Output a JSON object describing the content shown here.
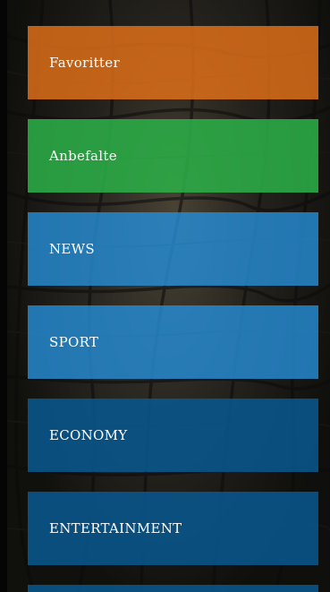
{
  "menu": {
    "items": [
      {
        "label": "Favoritter",
        "color": "#e47118"
      },
      {
        "label": "Anbefalte",
        "color": "#2cb248"
      },
      {
        "label": "NEWS",
        "color": "#268cd4"
      },
      {
        "label": "SPORT",
        "color": "#268cd4"
      },
      {
        "label": "ECONOMY",
        "color": "#08568c"
      },
      {
        "label": "ENTERTAINMENT",
        "color": "#08568c"
      }
    ]
  },
  "background": {
    "icon": "soccer-goal-net-image"
  }
}
